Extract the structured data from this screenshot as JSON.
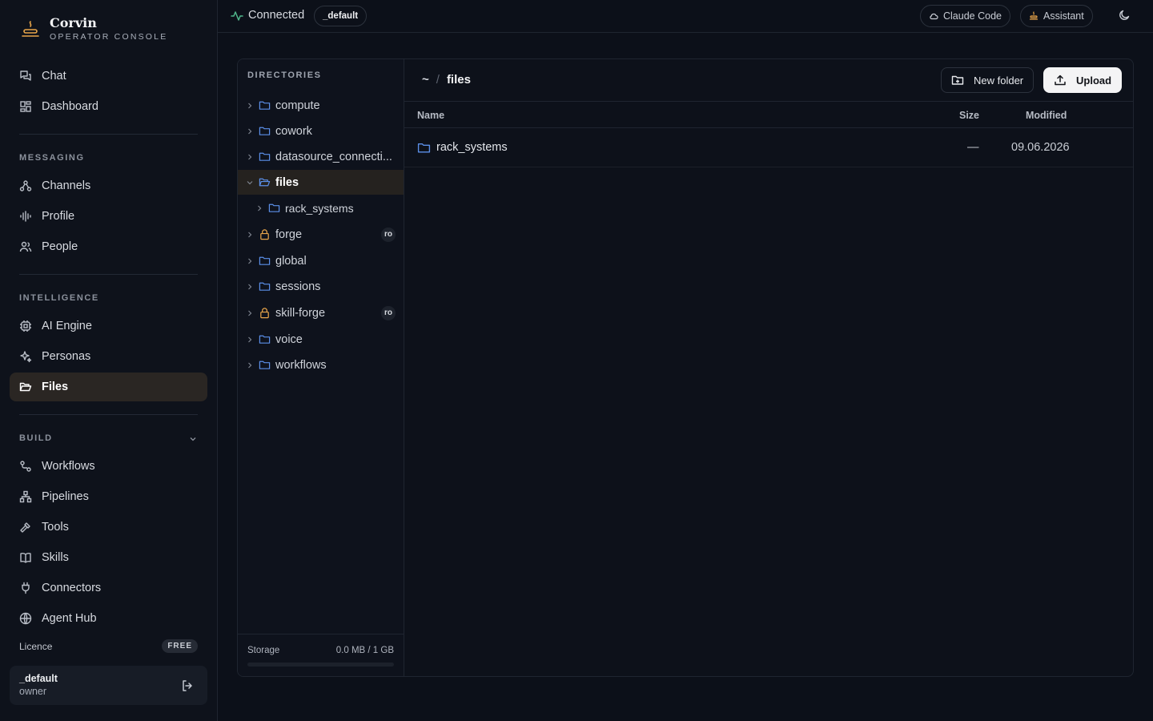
{
  "brand": {
    "name": "Corvin",
    "subtitle": "OPERATOR CONSOLE"
  },
  "sidebar": {
    "top_items": [
      {
        "label": "Chat",
        "icon": "chat-icon"
      },
      {
        "label": "Dashboard",
        "icon": "dashboard-icon"
      }
    ],
    "sections": [
      {
        "label": "MESSAGING",
        "items": [
          {
            "label": "Channels",
            "icon": "channels-icon"
          },
          {
            "label": "Profile",
            "icon": "audio-wave-icon"
          },
          {
            "label": "People",
            "icon": "people-icon"
          }
        ]
      },
      {
        "label": "INTELLIGENCE",
        "items": [
          {
            "label": "AI Engine",
            "icon": "cpu-icon"
          },
          {
            "label": "Personas",
            "icon": "sparkles-icon"
          },
          {
            "label": "Files",
            "icon": "folder-open-icon",
            "active": true
          }
        ]
      },
      {
        "label": "BUILD",
        "collapsible": true,
        "items": [
          {
            "label": "Workflows",
            "icon": "workflow-icon"
          },
          {
            "label": "Pipelines",
            "icon": "pipeline-icon"
          },
          {
            "label": "Tools",
            "icon": "hammer-icon"
          },
          {
            "label": "Skills",
            "icon": "book-icon"
          },
          {
            "label": "Connectors",
            "icon": "plug-icon"
          },
          {
            "label": "Agent Hub",
            "icon": "globe-icon"
          }
        ]
      }
    ],
    "licence": {
      "label": "Licence",
      "tier": "FREE"
    },
    "user": {
      "name": "_default",
      "role": "owner"
    }
  },
  "topbar": {
    "status": "Connected",
    "workspace": "_default",
    "buttons": {
      "claude_code": "Claude Code",
      "assistant": "Assistant"
    }
  },
  "tree": {
    "title": "DIRECTORIES",
    "items": [
      {
        "label": "compute",
        "icon": "folder-icon"
      },
      {
        "label": "cowork",
        "icon": "folder-icon"
      },
      {
        "label": "datasource_connecti...",
        "icon": "folder-icon"
      },
      {
        "label": "files",
        "icon": "folder-open-icon",
        "expanded": true,
        "active": true
      },
      {
        "label": "rack_systems",
        "icon": "folder-icon",
        "child": true
      },
      {
        "label": "forge",
        "icon": "lock-icon",
        "badge": "ro"
      },
      {
        "label": "global",
        "icon": "folder-icon"
      },
      {
        "label": "sessions",
        "icon": "folder-icon"
      },
      {
        "label": "skill-forge",
        "icon": "lock-icon",
        "badge": "ro"
      },
      {
        "label": "voice",
        "icon": "folder-icon"
      },
      {
        "label": "workflows",
        "icon": "folder-icon"
      }
    ],
    "storage": {
      "label": "Storage",
      "value": "0.0 MB / 1 GB",
      "fraction": 0.0
    }
  },
  "main": {
    "breadcrumb": {
      "home": "~",
      "sep": "/",
      "current": "files"
    },
    "new_folder_label": "New folder",
    "upload_label": "Upload",
    "columns": {
      "name": "Name",
      "size": "Size",
      "modified": "Modified"
    },
    "rows": [
      {
        "name": "rack_systems",
        "size": "—",
        "modified": "09.06.2026",
        "icon": "folder-icon"
      }
    ]
  },
  "colors": {
    "accent": "#e8a54a",
    "folder": "#5b8fe8",
    "connected": "#4fb58a",
    "background": "#0c1019"
  }
}
